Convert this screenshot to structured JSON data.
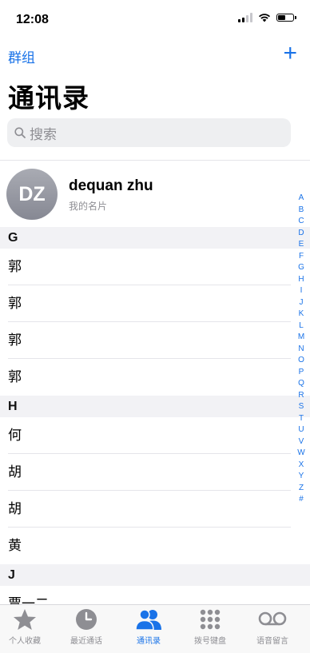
{
  "status": {
    "time": "12:08",
    "battery_level": 0.55
  },
  "nav": {
    "left_link": "群组",
    "add_symbol": "+"
  },
  "title": "通讯录",
  "search": {
    "placeholder": "搜索"
  },
  "my_card": {
    "initials": "DZ",
    "name": "dequan zhu",
    "subtitle": "我的名片"
  },
  "sections": [
    {
      "letter": "G",
      "rows": [
        "郭",
        "郭",
        "郭",
        "郭"
      ]
    },
    {
      "letter": "H",
      "rows": [
        "何",
        "胡",
        "胡",
        "黄"
      ]
    },
    {
      "letter": "J",
      "rows": [
        "贾一二"
      ]
    }
  ],
  "index_letters": [
    "A",
    "B",
    "C",
    "D",
    "E",
    "F",
    "G",
    "H",
    "I",
    "J",
    "K",
    "L",
    "M",
    "N",
    "O",
    "P",
    "Q",
    "R",
    "S",
    "T",
    "U",
    "V",
    "W",
    "X",
    "Y",
    "Z",
    "#"
  ],
  "tabs": [
    {
      "label": "个人收藏",
      "icon": "star-icon"
    },
    {
      "label": "最近通话",
      "icon": "clock-icon"
    },
    {
      "label": "通讯录",
      "icon": "contacts-icon",
      "active": true
    },
    {
      "label": "拨号键盘",
      "icon": "keypad-icon"
    },
    {
      "label": "语音留言",
      "icon": "voicemail-icon"
    }
  ],
  "colors": {
    "accent": "#1a73e8",
    "inactive": "#8e8e93"
  }
}
